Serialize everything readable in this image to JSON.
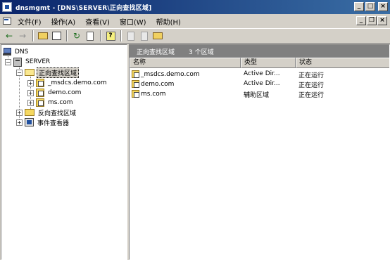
{
  "window": {
    "title": "dnsmgmt - [DNS\\SERVER\\正向查找区域]",
    "buttons": {
      "minimize": "_",
      "maximize": "□",
      "close": "×"
    }
  },
  "menu": {
    "items": [
      "文件(F)",
      "操作(A)",
      "查看(V)",
      "窗口(W)",
      "帮助(H)"
    ],
    "mdi_buttons": {
      "minimize": "_",
      "restore": "❐",
      "close": "×"
    }
  },
  "toolbar": {
    "icons": [
      "back-arrow-icon",
      "forward-arrow-icon",
      "up-folder-icon",
      "show-tree-icon",
      "refresh-icon",
      "export-list-icon",
      "help-icon",
      "properties-icon",
      "new-record-icon",
      "new-zone-icon"
    ]
  },
  "tree": {
    "root": "DNS",
    "server": "SERVER",
    "forward_zones": "正向查找区域",
    "zones": [
      "_msdcs.demo.com",
      "demo.com",
      "ms.com"
    ],
    "reverse_zones": "反向查找区域",
    "event_viewer": "事件查看器"
  },
  "list": {
    "header_title": "正向查找区域",
    "header_count": "3 个区域",
    "columns": [
      "名称",
      "类型",
      "状态"
    ],
    "rows": [
      {
        "name": "_msdcs.demo.com",
        "type": "Active Dir...",
        "status": "正在运行"
      },
      {
        "name": "demo.com",
        "type": "Active Dir...",
        "status": "正在运行"
      },
      {
        "name": "ms.com",
        "type": "辅助区域",
        "status": "正在运行"
      }
    ]
  }
}
